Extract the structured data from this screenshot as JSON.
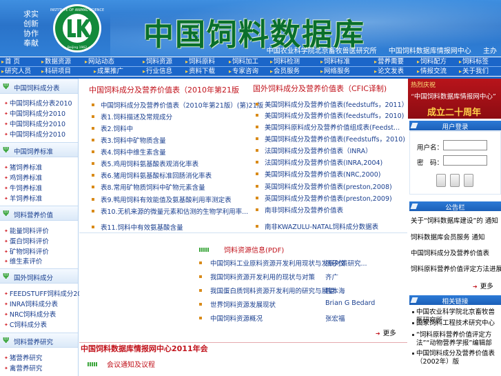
{
  "banner": {
    "motto": [
      "求实",
      "创新",
      "协作",
      "奉献"
    ],
    "logo_text": "INSTITUTE OF ANIMAL SCIENCE",
    "logo_year": "Beijing 1962",
    "title": "中国饲料数据库",
    "sub": [
      "中国农业科学院北京畜牧兽医研究所",
      "中国饲料数据库情报网中心",
      "主办"
    ]
  },
  "nav": {
    "row1": [
      "首  页",
      "数据资源",
      "网站动态",
      "饲料资源",
      "饲料原料",
      "饲料加工",
      "饲料检测",
      "饲料标准",
      "营养需要",
      "饲料配方",
      "饲料标签",
      "工作交流"
    ],
    "row2": [
      "研究人员",
      "科研项目",
      "成果推广",
      "行业信息",
      "资料下载",
      "专家咨询",
      "会员服务",
      "网络服务",
      "论文发表",
      "情报交流",
      "关于我们",
      "联系我们"
    ]
  },
  "left": {
    "sections": [
      {
        "title": "中国饲料成分表",
        "items": [
          "中国饲料成分表2010",
          "中国饲料成分2010",
          "中国饲料成分2010",
          "中国饲料成分2010"
        ]
      },
      {
        "title": "中国饲养标准",
        "items": [
          "猪饲养标准",
          "鸡饲养标准",
          "牛饲养标准",
          "羊饲养标准"
        ]
      },
      {
        "title": "饲料营养价值",
        "items": [
          "能量饲料评价",
          "蛋白饲料评价",
          "矿物饲料评价",
          "维生素评价"
        ]
      },
      {
        "title": "国外饲料成分",
        "items": [
          "FEEDSTUFF饲料成分2007",
          "INRA饲料成分表",
          "NRC饲料成分表",
          "C饲料成分表"
        ]
      },
      {
        "title": "饲料营养研究",
        "items": [
          "猪营养研究",
          "禽营养研究"
        ]
      }
    ]
  },
  "center": {
    "left_list_title": "中国饲料成分及营养价值表（2010年第21版",
    "left_list": [
      "中国饲料成分及营养价值表（2010年第21版）(第)21版",
      "表1.饲料描述及常规成分",
      "表2.饲料中",
      "表3.饲料中矿物质含量",
      "表4.饲料中维生素含量",
      "表5.鸡用饲料氨基酸表观消化率表",
      "表6.猪用饲料氨基酸标准回肠消化率表",
      "表8.常用矿物质饲料中矿物元素含量",
      "表9.鸭用饲料有效能值及氨基酸利用率测定表",
      "表10.无机来源的微量元素和估测的生物学利用率...",
      "表11.饲料中有效氨基酸含量"
    ],
    "right_list_title": "国外饲料成分及营养价值表（CFIC译制)",
    "right_list": [
      "美国饲料成分及营养价值表(feedstuffs，2011）",
      "美国饲料成分及营养价值表(feedstuffs，2010)",
      "美国饲料原料成分及营养价值组成表(Feedst...",
      "美国饲料成分及营养价值表(Feedstuffs，2010)",
      "法国饲料成分及营养价值表（INRA）",
      "法国饲料成分及营养价值表(INRA,2004)",
      "美国饲料成分及营养价值表(NRC,2000)",
      "英国饲料成分及营养价值表(preston,2008)",
      "英国饲料成分及营养价值表(preston,2009)",
      "南非饲料成分及营养价值表",
      "南非KWAZULU-NATAL饲料成分数据表"
    ],
    "pdf_title": "饲料资源信息(PDF)",
    "pdf_rows": [
      {
        "title": "中国饲料工业原料资源开发利用现状与发展对策研究...",
        "author": "张子仪"
      },
      {
        "title": "我国饲料资源开发利用的现状与对策",
        "author": "齐广"
      },
      {
        "title": "我国蛋白质饲料资源开发利用的研究与展望",
        "author": "熊本海"
      },
      {
        "title": "世界饲料资源发展现状",
        "author": "Brian G Bedard"
      },
      {
        "title": "中国饲料资源概况",
        "author": "张宏福"
      }
    ],
    "more_label": "更多",
    "announce_title": "中国饲料数据库情报网中心2011年会",
    "announce_sub": "会议通知及议程"
  },
  "right": {
    "promo": [
      "热烈庆祝",
      "“中国饲料数据库情报网中心”",
      "成立二十周年"
    ],
    "login_title": "用户登录",
    "login_user_label": "用户名：",
    "login_pass_label": "密　码：",
    "news_title": "公告栏",
    "news": [
      "关于“饲料数据库建设”的 通知",
      "饲料数据库会员服务 通知",
      "中国饲料成分及营养价值表",
      "饲料原料营养价值评定方法进展"
    ],
    "more_label": "更多",
    "links_title": "相关链接",
    "links": [
      "中国农业科学院北京畜牧兽医研究所",
      "国家饲料工程技术研究中心",
      "“饲料原料营养价值评定方法”“动物营养学报”编辑部",
      "中国饲料成分及营养价值表（2002年）版"
    ]
  }
}
